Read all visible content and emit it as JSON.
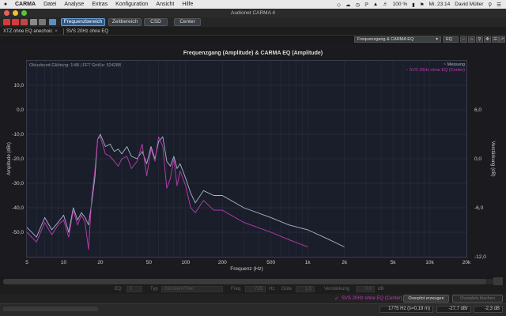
{
  "menubar": {
    "app_name": "CARMA",
    "items": [
      "Datei",
      "Analyse",
      "Extras",
      "Konfiguration",
      "Ansicht",
      "Hilfe"
    ],
    "battery": "100 %",
    "clock": "Mi. 23:14",
    "user": "David Müller"
  },
  "window": {
    "title": "Audionet CARMA 4"
  },
  "toolbar": {
    "buttons": [
      "Frequenzbereich",
      "Zeitbereich",
      "CSD",
      "Center"
    ]
  },
  "tabs": [
    {
      "label": "XTZ ohne EQ anechoic"
    },
    {
      "label": "SVS 20Hz ohne EQ"
    }
  ],
  "subbar": {
    "view_select": "Frequenzgang & CARMA EQ",
    "eq_select": "EQ"
  },
  "chart_data": {
    "type": "line",
    "title": "Frequenzgang (Amplitude) & CARMA EQ (Amplitude)",
    "info": "Oktavband-Glättung: 1/48 | FFT Größe: 524288",
    "xlabel": "Frequenz (Hz)",
    "ylabel": "Amplitude (dBr)",
    "y2label": "Verstärkung (dB)",
    "xscale": "log",
    "xlim": [
      5,
      20000
    ],
    "ylim": [
      -60,
      20
    ],
    "y2lim": [
      -12,
      12
    ],
    "x_ticks": [
      5,
      10,
      20,
      50,
      100,
      200,
      500,
      1000,
      2000,
      5000,
      10000,
      20000
    ],
    "x_tick_labels": [
      "5",
      "10",
      "20",
      "50",
      "100",
      "200",
      "500",
      "1k",
      "2k",
      "5k",
      "10k",
      "20k"
    ],
    "y_ticks": [
      10,
      0,
      -10,
      -20,
      -30,
      -40,
      -50
    ],
    "y_tick_labels": [
      "10,0",
      "0,0",
      "-10,0",
      "-20,0",
      "-30,0",
      "-40,0",
      "-50,0"
    ],
    "y2_ticks": [
      6,
      0,
      -6,
      -12
    ],
    "y2_tick_labels": [
      "6,0",
      "0,0",
      "-6,0",
      "-12,0"
    ],
    "grid": true,
    "legend_position": "top-right",
    "series": [
      {
        "name": "Messung",
        "color": "#a9b6cc",
        "x": [
          5,
          6,
          7,
          8,
          9,
          10,
          11,
          12,
          13,
          14,
          15,
          16,
          17,
          18,
          19,
          20,
          22,
          24,
          26,
          28,
          30,
          33,
          36,
          40,
          44,
          48,
          52,
          56,
          60,
          65,
          70,
          75,
          80,
          85,
          90,
          100,
          110,
          120,
          140,
          170,
          200,
          300,
          500,
          700,
          1000,
          1500,
          2000
        ],
        "y": [
          -48,
          -52,
          -44,
          -49,
          -46,
          -43,
          -50,
          -40,
          -45,
          -42,
          -44,
          -47,
          -38,
          -28,
          -12,
          -10,
          -15,
          -14,
          -17,
          -16,
          -18,
          -15,
          -19,
          -20,
          -17,
          -22,
          -15,
          -20,
          -13,
          -11,
          -21,
          -23,
          -19,
          -24,
          -22,
          -28,
          -34,
          -38,
          -33,
          -35,
          -35,
          -40,
          -44,
          -47,
          -49,
          -53,
          -56
        ]
      },
      {
        "name": "SVS 20Hz ohne EQ (Center)",
        "color": "#c03ab4",
        "x": [
          5,
          6,
          7,
          8,
          9,
          10,
          11,
          12,
          13,
          14,
          15,
          16,
          17,
          18,
          19,
          20,
          22,
          24,
          26,
          28,
          30,
          33,
          36,
          40,
          44,
          48,
          52,
          56,
          60,
          65,
          70,
          75,
          80,
          85,
          90,
          100,
          110,
          120,
          140,
          170,
          200,
          300,
          500,
          700,
          1000
        ],
        "y": [
          -50,
          -54,
          -46,
          -51,
          -47,
          -45,
          -52,
          -41,
          -47,
          -43,
          -46,
          -57,
          -36,
          -25,
          -12,
          -11,
          -18,
          -19,
          -21,
          -23,
          -20,
          -19,
          -24,
          -21,
          -14,
          -27,
          -16,
          -21,
          -11,
          -15,
          -32,
          -28,
          -20,
          -31,
          -25,
          -31,
          -40,
          -42,
          -37,
          -41,
          -41,
          -46,
          -50,
          -53,
          -56
        ]
      }
    ]
  },
  "eqbar": {
    "eq_label": "EQ",
    "eq_index": "1",
    "typ_label": "Typ",
    "typ_value": "Glocken-Filter",
    "freq_label": "Freq",
    "freq_value": "725",
    "freq_unit": "Hz",
    "guete_label": "Güte",
    "guete_value": "1,0",
    "verst_label": "Verstärkung",
    "verst_value": "0,0",
    "verst_unit": "dB"
  },
  "bottombar": {
    "checkbox_label": "SVS 20Hz ohne EQ (Center)",
    "overplot_button": "Overplot erzeugen",
    "overplot_remove_button": "Overplots löschen"
  },
  "statusbar": {
    "frequency": "1775 Hz (λ=0,19 m)",
    "amplitude": "-27,7 dBr",
    "gain": "-2,3 dB"
  }
}
